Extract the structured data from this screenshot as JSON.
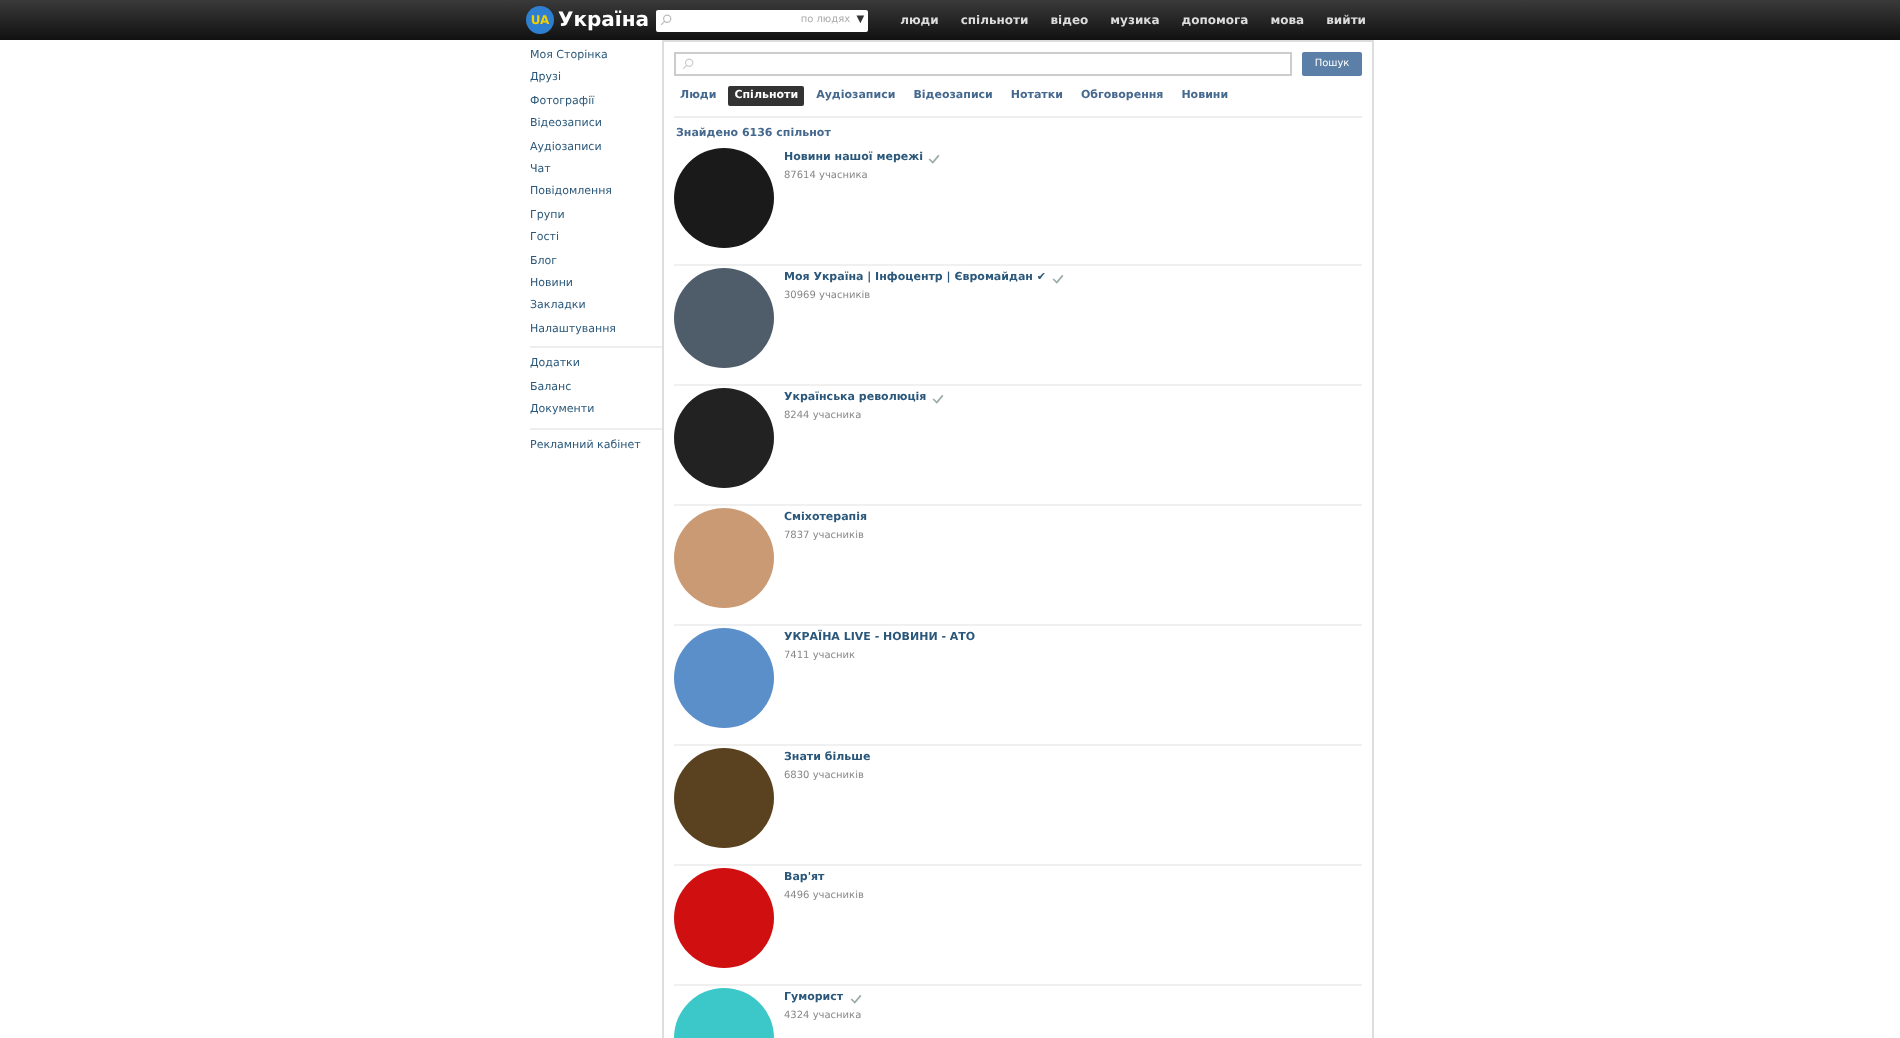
{
  "header": {
    "logo_badge": "UA",
    "logo": "Україна",
    "search": {
      "placeholder": "по людях",
      "dropdown_arrow": "▼"
    },
    "nav": [
      "люди",
      "спільноти",
      "відео",
      "музика",
      "допомога",
      "мова",
      "вийти"
    ]
  },
  "sidebar": {
    "groups": [
      [
        "Моя Сторінка",
        "Друзі",
        "Фотографії",
        "Відеозаписи",
        "Аудіозаписи",
        "Чат",
        "Повідомлення",
        "Групи",
        "Гості",
        "Блог",
        "Новини",
        "Закладки",
        "Налаштування"
      ],
      [
        "Додатки",
        "Баланс",
        "Документи"
      ],
      [
        "Рекламний кабінет"
      ]
    ]
  },
  "search": {
    "button": "Пошук"
  },
  "tabs": [
    {
      "label": "Люди",
      "selected": false
    },
    {
      "label": "Спільноти",
      "selected": true
    },
    {
      "label": "Аудіозаписи",
      "selected": false
    },
    {
      "label": "Відеозаписи",
      "selected": false
    },
    {
      "label": "Нотатки",
      "selected": false
    },
    {
      "label": "Обговорення",
      "selected": false
    },
    {
      "label": "Новини",
      "selected": false
    }
  ],
  "results_count": "Знайдено 6136 спільнот",
  "communities": [
    {
      "name": "Новини нашої мережі",
      "members": "87614 учасника",
      "verified": true,
      "color": "#1a1a1a"
    },
    {
      "name": "Моя Україна | Інфоцентр | Євромайдан ✔",
      "members": "30969 учасників",
      "verified": true,
      "color": "#4f5d6b"
    },
    {
      "name": "Українська революція",
      "members": "8244 учасника",
      "verified": true,
      "color": "#222222"
    },
    {
      "name": "Сміхотерапія",
      "members": "7837 учасників",
      "verified": false,
      "color": "#c99a74"
    },
    {
      "name": "УКРАЇНА LIVE - НОВИНИ - АТО",
      "members": "7411 учасник",
      "verified": false,
      "color": "#5b8fc9"
    },
    {
      "name": "Знати більше",
      "members": "6830 учасників",
      "verified": false,
      "color": "#5a4220"
    },
    {
      "name": "Вар'ят",
      "members": "4496 учасників",
      "verified": false,
      "color": "#d01010"
    },
    {
      "name": "Гуморист",
      "members": "4324 учасника",
      "verified": true,
      "color": "#3cc7c9"
    }
  ]
}
